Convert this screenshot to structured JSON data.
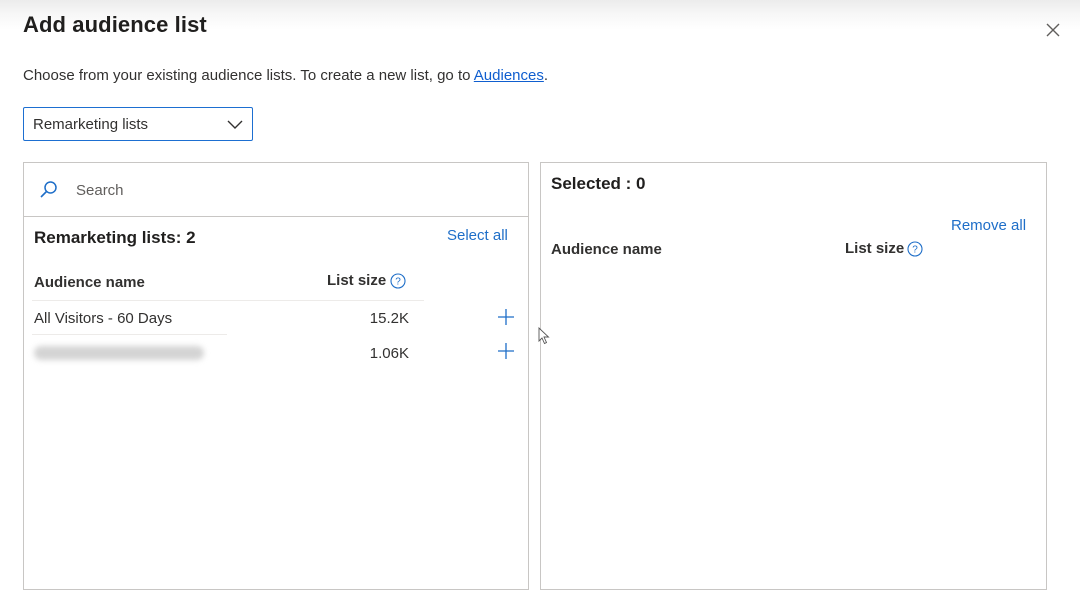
{
  "dialog": {
    "title": "Add audience list",
    "description_prefix": "Choose from your existing audience lists. To create a new list, go to ",
    "description_link": "Audiences",
    "description_suffix": "."
  },
  "filter": {
    "selected": "Remarketing lists"
  },
  "left_panel": {
    "search_placeholder": "Search",
    "heading": "Remarketing lists:  2",
    "select_all_label": "Select all",
    "columns": {
      "audience_name": "Audience name",
      "list_size": "List size"
    },
    "rows": [
      {
        "name": "All Visitors - 60 Days",
        "size": "15.2K"
      },
      {
        "name": "",
        "size": "1.06K"
      }
    ]
  },
  "right_panel": {
    "heading": "Selected :  0",
    "remove_all_label": "Remove all",
    "columns": {
      "audience_name": "Audience name",
      "list_size": "List size"
    }
  },
  "colors": {
    "link": "#1e6ec8",
    "border": "#c8c6c4",
    "focus": "#1d6fd1"
  },
  "icons": [
    "close-icon",
    "chevron-down-icon",
    "search-icon",
    "help-icon",
    "plus-icon",
    "cursor-icon"
  ]
}
